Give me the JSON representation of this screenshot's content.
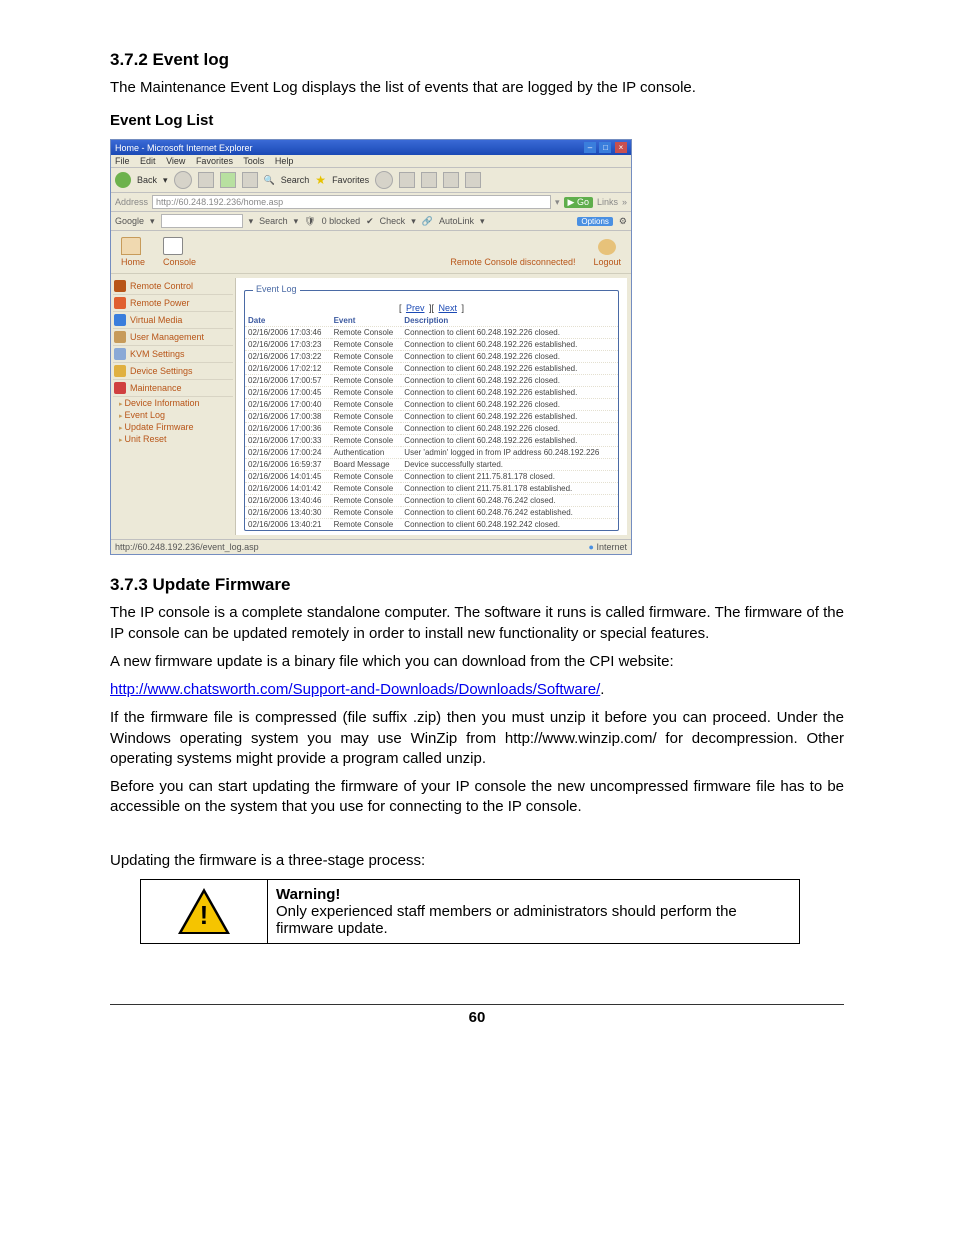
{
  "section_eventlog": {
    "heading": "3.7.2 Event log",
    "intro": "The Maintenance Event Log displays the list of events that are logged by the IP console.",
    "subheading": "Event Log List"
  },
  "screenshot": {
    "titlebar": "Home - Microsoft Internet Explorer",
    "menus": [
      "File",
      "Edit",
      "View",
      "Favorites",
      "Tools",
      "Help"
    ],
    "ie": {
      "back": "Back",
      "search": "Search",
      "fav": "Favorites"
    },
    "address_label": "Address",
    "address_url": "http://60.248.192.236/home.asp",
    "go": "Go",
    "links": "Links",
    "google": {
      "label": "Google",
      "search": "Search",
      "blocked": "0 blocked",
      "check": "Check",
      "autolink": "AutoLink",
      "options": "Options"
    },
    "top": {
      "home": "Home",
      "console": "Console",
      "status": "Remote Console disconnected!",
      "logout": "Logout"
    },
    "side": {
      "rc": "Remote Control",
      "rp": "Remote Power",
      "vm": "Virtual Media",
      "um": "User Management",
      "kvm": "KVM Settings",
      "dev": "Device Settings",
      "mnt": "Maintenance",
      "sub": [
        "Device Information",
        "Event Log",
        "Update Firmware",
        "Unit Reset"
      ]
    },
    "panel": {
      "legend": "Event Log",
      "prev": "Prev",
      "next": "Next",
      "cols": {
        "date": "Date",
        "event": "Event",
        "desc": "Description"
      },
      "rows": [
        {
          "d": "02/16/2006 17:03:46",
          "e": "Remote Console",
          "x": "Connection to client 60.248.192.226 closed."
        },
        {
          "d": "02/16/2006 17:03:23",
          "e": "Remote Console",
          "x": "Connection to client 60.248.192.226 established."
        },
        {
          "d": "02/16/2006 17:03:22",
          "e": "Remote Console",
          "x": "Connection to client 60.248.192.226 closed."
        },
        {
          "d": "02/16/2006 17:02:12",
          "e": "Remote Console",
          "x": "Connection to client 60.248.192.226 established."
        },
        {
          "d": "02/16/2006 17:00:57",
          "e": "Remote Console",
          "x": "Connection to client 60.248.192.226 closed."
        },
        {
          "d": "02/16/2006 17:00:45",
          "e": "Remote Console",
          "x": "Connection to client 60.248.192.226 established."
        },
        {
          "d": "02/16/2006 17:00:40",
          "e": "Remote Console",
          "x": "Connection to client 60.248.192.226 closed."
        },
        {
          "d": "02/16/2006 17:00:38",
          "e": "Remote Console",
          "x": "Connection to client 60.248.192.226 established."
        },
        {
          "d": "02/16/2006 17:00:36",
          "e": "Remote Console",
          "x": "Connection to client 60.248.192.226 closed."
        },
        {
          "d": "02/16/2006 17:00:33",
          "e": "Remote Console",
          "x": "Connection to client 60.248.192.226 established."
        },
        {
          "d": "02/16/2006 17:00:24",
          "e": "Authentication",
          "x": "User 'admin' logged in from IP address 60.248.192.226"
        },
        {
          "d": "02/16/2006 16:59:37",
          "e": "Board Message",
          "x": "Device successfully started."
        },
        {
          "d": "02/16/2006 14:01:45",
          "e": "Remote Console",
          "x": "Connection to client 211.75.81.178 closed."
        },
        {
          "d": "02/16/2006 14:01:42",
          "e": "Remote Console",
          "x": "Connection to client 211.75.81.178 established."
        },
        {
          "d": "02/16/2006 13:40:46",
          "e": "Remote Console",
          "x": "Connection to client 60.248.76.242 closed."
        },
        {
          "d": "02/16/2006 13:40:30",
          "e": "Remote Console",
          "x": "Connection to client 60.248.76.242 established."
        },
        {
          "d": "02/16/2006 13:40:21",
          "e": "Remote Console",
          "x": "Connection to client 60.248.192.242 closed."
        }
      ]
    },
    "status": {
      "url": "http://60.248.192.236/event_log.asp",
      "zone": "Internet"
    }
  },
  "section_firmware": {
    "heading": "3.7.3 Update Firmware",
    "p1": "The IP console is a complete standalone computer. The software it runs is called firmware. The firmware of the IP console can be updated remotely in order to install new functionality or special features.",
    "p2": "A new firmware update is a binary file which you can download from the CPI website:",
    "link": "http://www.chatsworth.com/Support-and-Downloads/Downloads/Software/",
    "p3": "If the firmware file is compressed (file suffix .zip) then you must unzip it before you can proceed. Under the Windows operating system you may use WinZip from http://www.winzip.com/ for decompression. Other operating systems might provide a program called unzip.",
    "p4": "Before you can start updating the firmware of your IP console the new uncompressed firmware file has to be accessible on the system that you use for connecting to the IP console.",
    "p5": "Updating the firmware is a three-stage process:"
  },
  "warning": {
    "title": "Warning!",
    "text": "Only experienced staff members or administrators should perform the firmware update."
  },
  "page": "60"
}
